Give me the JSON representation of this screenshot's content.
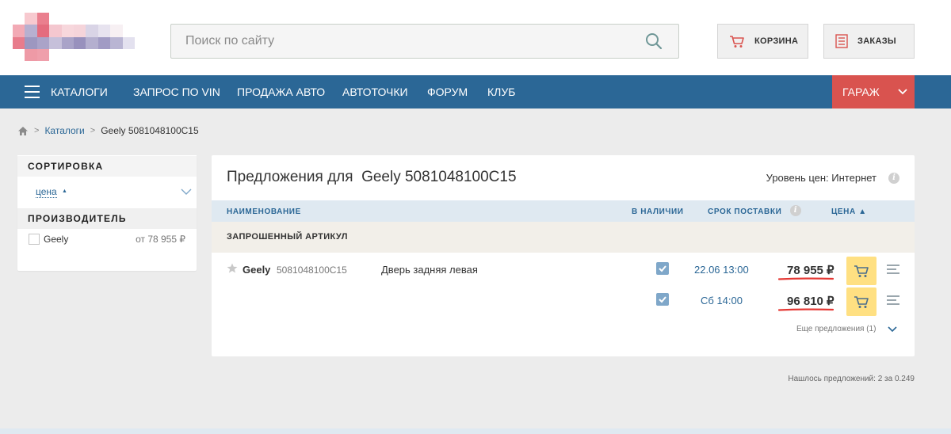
{
  "colors": {
    "nav_bg": "#2b6796",
    "garage_bg": "#d9534f",
    "cart_button": "#ffe082",
    "price_underline": "#e53935",
    "link": "#2b6796"
  },
  "search": {
    "placeholder": "Поиск по сайту",
    "icon": "search-icon"
  },
  "header": {
    "cart_label": "КОРЗИНА",
    "orders_label": "ЗАКАЗЫ"
  },
  "nav": {
    "items": [
      "КАТАЛОГИ",
      "ЗАПРОС ПО VIN",
      "ПРОДАЖА АВТО",
      "АВТОТОЧКИ",
      "ФОРУМ",
      "КЛУБ"
    ],
    "garage": "ГАРАЖ"
  },
  "breadcrumb": {
    "link": "Каталоги",
    "current": "Geely 5081048100C15"
  },
  "sidebar": {
    "sort_title": "СОРТИРОВКА",
    "sort_value": "цена",
    "maker_title": "ПРОИЗВОДИТЕЛЬ",
    "maker": {
      "name": "Geely",
      "price": "от 78 955 ₽"
    }
  },
  "panel": {
    "title": "Предложения для  Geely 5081048100C15",
    "price_level": "Уровень цен: Интернет",
    "columns": {
      "name": "НАИМЕНОВАНИЕ",
      "stock": "В НАЛИЧИИ",
      "delivery": "СРОК ПОСТАВКИ",
      "price": "ЦЕНА ▲"
    },
    "group": "ЗАПРОШЕННЫЙ АРТИКУЛ",
    "rows": [
      {
        "brand": "Geely",
        "article": "5081048100C15",
        "description": "Дверь задняя левая",
        "delivery": "22.06 13:00",
        "price": "78 955 ₽"
      },
      {
        "delivery": "Сб 14:00",
        "price": "96 810 ₽"
      }
    ],
    "more": "Еще предложения (1)"
  },
  "footer_note": "Нашлось предложений: 2 за 0.249"
}
